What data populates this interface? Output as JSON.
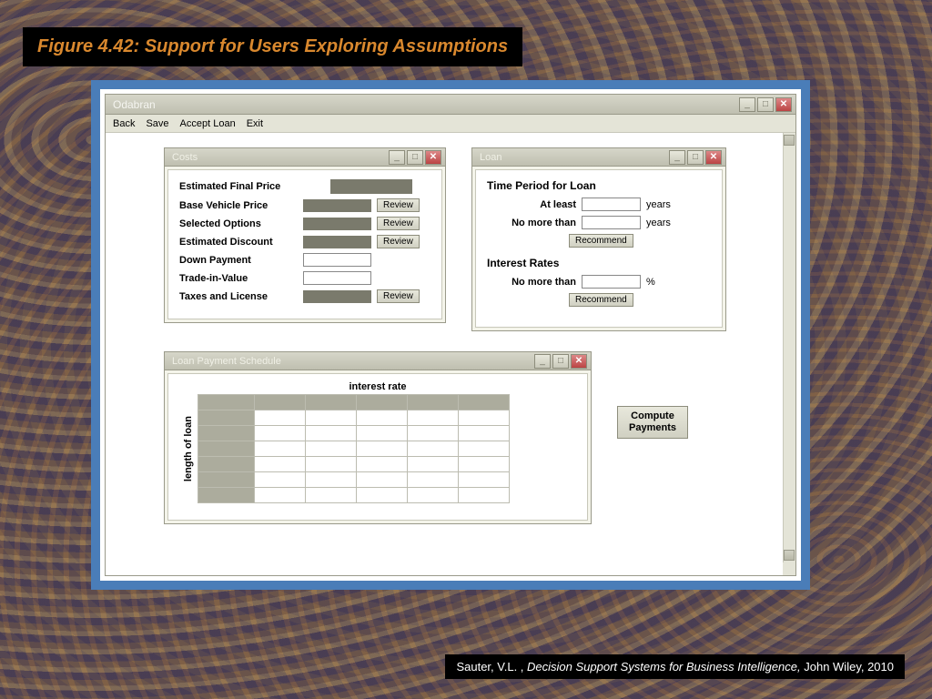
{
  "caption": {
    "title": "Figure 4.42:  Support for Users Exploring Assumptions"
  },
  "credit": {
    "author": "Sauter, V.L. , ",
    "book": "Decision Support Systems for Business Intelligence, ",
    "pub": "John Wiley, 2010"
  },
  "app": {
    "title": "Odabran",
    "menu": [
      "Back",
      "Save",
      "Accept Loan",
      "Exit"
    ]
  },
  "costs": {
    "title": "Costs",
    "heading": "Estimated Final Price",
    "rows": [
      {
        "label": "Base Vehicle Price",
        "type": "bar",
        "review": true
      },
      {
        "label": "Selected Options",
        "type": "bar",
        "review": true
      },
      {
        "label": "Estimated Discount",
        "type": "bar",
        "review": true
      },
      {
        "label": "Down Payment",
        "type": "input",
        "review": false
      },
      {
        "label": "Trade-in-Value",
        "type": "input",
        "review": false
      },
      {
        "label": "Taxes and License",
        "type": "bar",
        "review": true
      }
    ],
    "review_label": "Review"
  },
  "loan": {
    "title": "Loan",
    "time_heading": "Time Period for Loan",
    "at_least": "At least",
    "no_more": "No more than",
    "years": "years",
    "rates_heading": "Interest Rates",
    "percent": "%",
    "recommend": "Recommend"
  },
  "schedule": {
    "title": "Loan Payment Schedule",
    "x_axis": "interest rate",
    "y_axis": "length of loan",
    "cols": 5,
    "rows": 6
  },
  "compute": "Compute\nPayments"
}
